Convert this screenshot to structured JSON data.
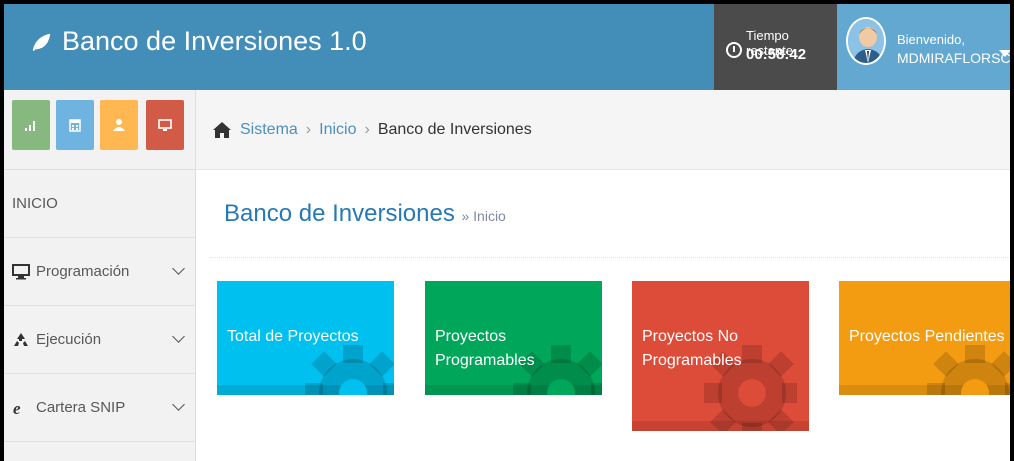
{
  "app": {
    "title": "Banco de Inversiones 1.0"
  },
  "timer": {
    "label": "Tiempo restante",
    "value": "00:58:42"
  },
  "user": {
    "greeting": "Bienvenido,",
    "name": "MDMIRAFLORSC"
  },
  "shortcuts": [
    {
      "icon": "signal-icon",
      "color": "#87b87f"
    },
    {
      "icon": "calendar-icon",
      "color": "#6fb3e0"
    },
    {
      "icon": "users-icon",
      "color": "#ffb752"
    },
    {
      "icon": "monitor-icon",
      "color": "#d15b47"
    }
  ],
  "breadcrumb": {
    "items": [
      "Sistema",
      "Inicio",
      "Banco de Inversiones"
    ]
  },
  "sidebar": {
    "items": [
      {
        "label": "INICIO",
        "icon": "",
        "expandable": false
      },
      {
        "label": "Programación",
        "icon": "desktop-icon",
        "expandable": true
      },
      {
        "label": "Ejecución",
        "icon": "recycle-icon",
        "expandable": true
      },
      {
        "label": "Cartera SNIP",
        "icon": "ie-icon",
        "expandable": true
      }
    ]
  },
  "page": {
    "title": "Banco de Inversiones",
    "subtitle": "» Inicio"
  },
  "tiles": [
    {
      "label": "Total de Proyectos",
      "color": "#00c0ef"
    },
    {
      "label": "Proyectos Programables",
      "color": "#00a65a"
    },
    {
      "label": "Proyectos No Programables",
      "color": "#dd4b39"
    },
    {
      "label": "Proyectos Pendientes",
      "color": "#f39c12"
    }
  ]
}
